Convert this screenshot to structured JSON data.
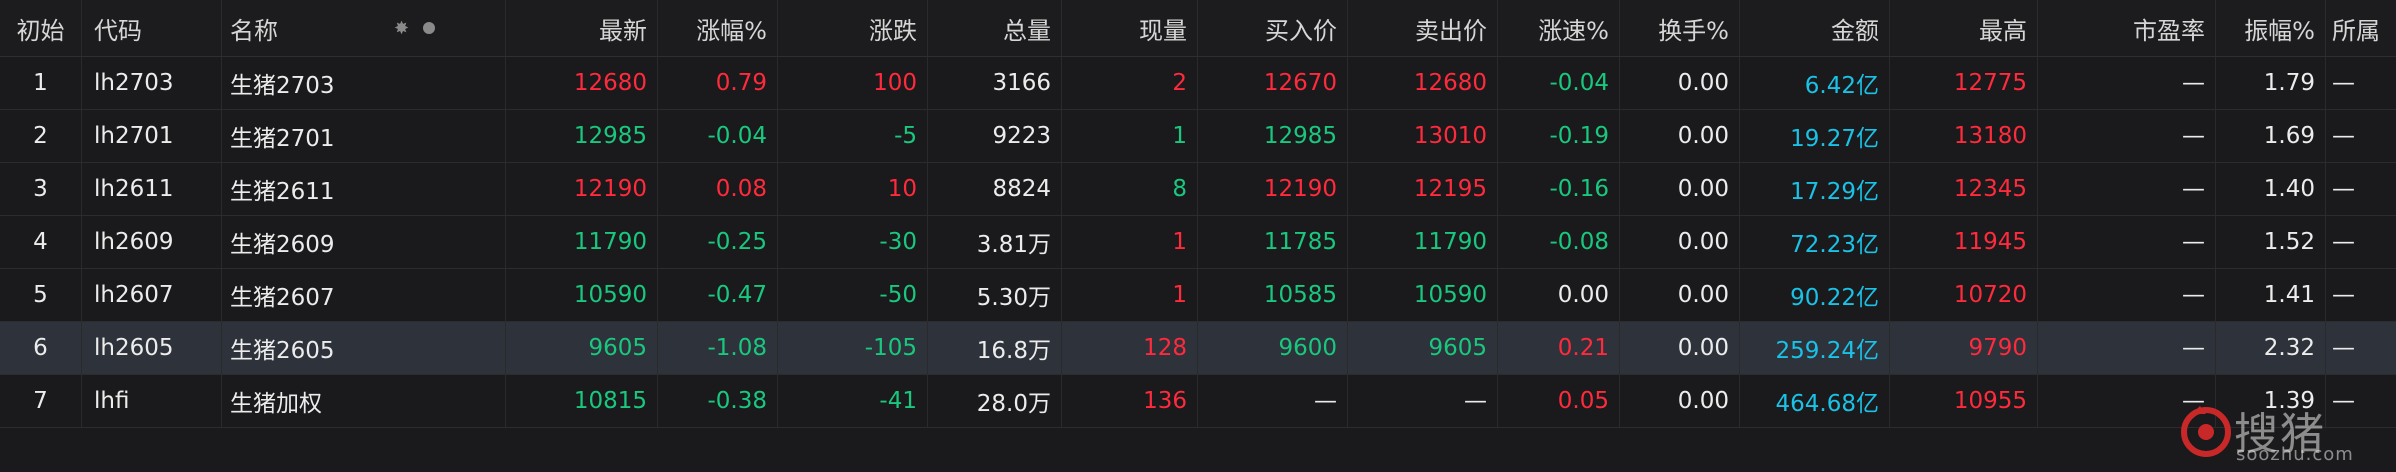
{
  "headers": {
    "idx": "初始",
    "code": "代码",
    "name": "名称",
    "last": "最新",
    "pct": "涨幅%",
    "chg": "涨跌",
    "vol": "总量",
    "cur": "现量",
    "bid": "买入价",
    "ask": "卖出价",
    "speed": "涨速%",
    "turnover": "换手%",
    "amount": "金额",
    "high": "最高",
    "pe": "市盈率",
    "amp": "振幅%",
    "sector": "所属"
  },
  "rows": [
    {
      "idx": "1",
      "code": "lh2703",
      "name": "生猪2703",
      "last": "12680",
      "pct": "0.79",
      "chg": "100",
      "vol": "3166",
      "cur": "2",
      "bid": "12670",
      "ask": "12680",
      "speed": "-0.04",
      "turnover": "0.00",
      "amount": "6.42亿",
      "high": "12775",
      "pe": "—",
      "amp": "1.79",
      "sector": "—"
    },
    {
      "idx": "2",
      "code": "lh2701",
      "name": "生猪2701",
      "last": "12985",
      "pct": "-0.04",
      "chg": "-5",
      "vol": "9223",
      "cur": "1",
      "bid": "12985",
      "ask": "13010",
      "speed": "-0.19",
      "turnover": "0.00",
      "amount": "19.27亿",
      "high": "13180",
      "pe": "—",
      "amp": "1.69",
      "sector": "—"
    },
    {
      "idx": "3",
      "code": "lh2611",
      "name": "生猪2611",
      "last": "12190",
      "pct": "0.08",
      "chg": "10",
      "vol": "8824",
      "cur": "8",
      "bid": "12190",
      "ask": "12195",
      "speed": "-0.16",
      "turnover": "0.00",
      "amount": "17.29亿",
      "high": "12345",
      "pe": "—",
      "amp": "1.40",
      "sector": "—"
    },
    {
      "idx": "4",
      "code": "lh2609",
      "name": "生猪2609",
      "last": "11790",
      "pct": "-0.25",
      "chg": "-30",
      "vol": "3.81万",
      "cur": "1",
      "bid": "11785",
      "ask": "11790",
      "speed": "-0.08",
      "turnover": "0.00",
      "amount": "72.23亿",
      "high": "11945",
      "pe": "—",
      "amp": "1.52",
      "sector": "—"
    },
    {
      "idx": "5",
      "code": "lh2607",
      "name": "生猪2607",
      "last": "10590",
      "pct": "-0.47",
      "chg": "-50",
      "vol": "5.30万",
      "cur": "1",
      "bid": "10585",
      "ask": "10590",
      "speed": "0.00",
      "turnover": "0.00",
      "amount": "90.22亿",
      "high": "10720",
      "pe": "—",
      "amp": "1.41",
      "sector": "—"
    },
    {
      "idx": "6",
      "code": "lh2605",
      "name": "生猪2605",
      "last": "9605",
      "pct": "-1.08",
      "chg": "-105",
      "vol": "16.8万",
      "cur": "128",
      "bid": "9600",
      "ask": "9605",
      "speed": "0.21",
      "turnover": "0.00",
      "amount": "259.24亿",
      "high": "9790",
      "pe": "—",
      "amp": "2.32",
      "sector": "—"
    },
    {
      "idx": "7",
      "code": "lhfi",
      "name": "生猪加权",
      "last": "10815",
      "pct": "-0.38",
      "chg": "-41",
      "vol": "28.0万",
      "cur": "136",
      "bid": "—",
      "ask": "—",
      "speed": "0.05",
      "turnover": "0.00",
      "amount": "464.68亿",
      "high": "10955",
      "pe": "—",
      "amp": "1.39",
      "sector": "—"
    }
  ],
  "colors": {
    "up": "#ff2a3c",
    "down": "#19c87e",
    "amount": "#19c2e6",
    "background": "#1a1a1c",
    "selected_row": "#2d323b"
  },
  "header_icons": [
    "gear-icon",
    "dot-icon"
  ],
  "watermark": {
    "text": "搜猪",
    "url": "soozhu.com"
  }
}
